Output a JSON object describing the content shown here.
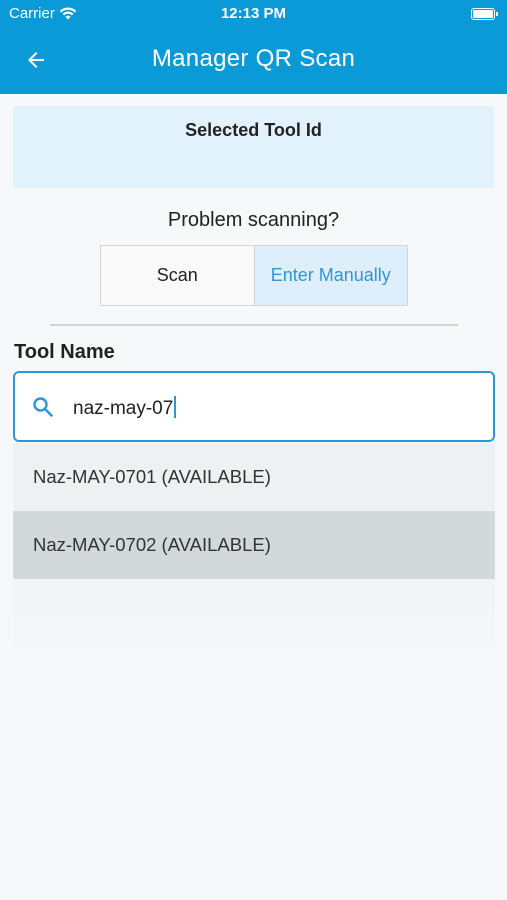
{
  "status_bar": {
    "carrier": "Carrier",
    "time": "12:13 PM"
  },
  "header": {
    "title": "Manager QR Scan",
    "back_icon": "arrow-left-icon"
  },
  "tool_id_card": {
    "label": "Selected Tool Id"
  },
  "problem_text": "Problem scanning?",
  "segmented_control": {
    "options": [
      {
        "label": "Scan",
        "selected": false
      },
      {
        "label": "Enter Manually",
        "selected": true
      }
    ]
  },
  "tool_name": {
    "label": "Tool Name",
    "search_icon": "search-icon",
    "value": "naz-may-07"
  },
  "results": [
    {
      "text": "Naz-MAY-0701 (AVAILABLE)"
    },
    {
      "text": "Naz-MAY-0702 (AVAILABLE)"
    }
  ],
  "colors": {
    "header": "#0a9ad8",
    "accent": "#2c97d8",
    "card_bg": "#e1f2fc"
  }
}
